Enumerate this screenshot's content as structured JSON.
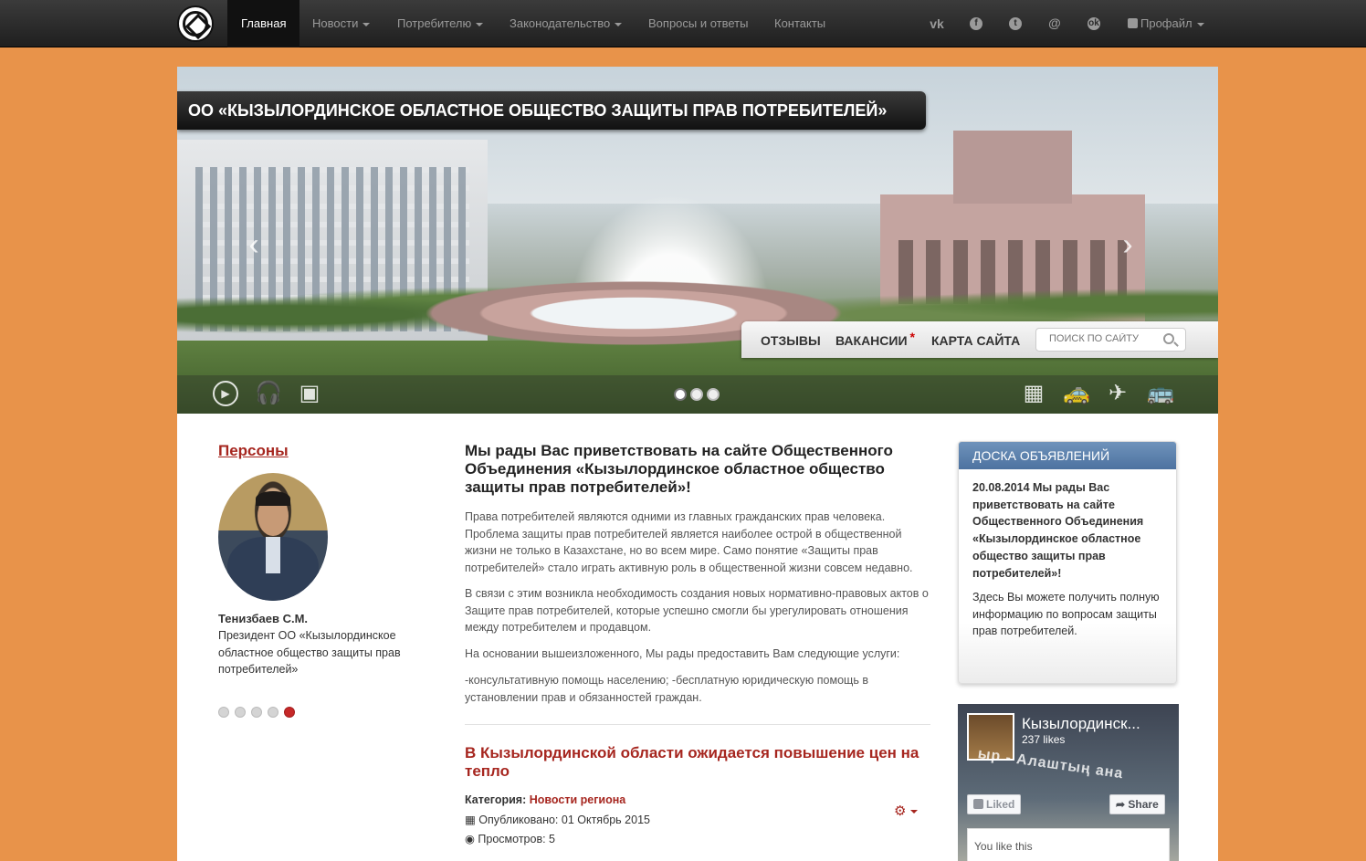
{
  "nav": {
    "items": [
      {
        "label": "Главная",
        "active": true
      },
      {
        "label": "Новости",
        "dropdown": true
      },
      {
        "label": "Потребителю",
        "dropdown": true
      },
      {
        "label": "Законодательство",
        "dropdown": true
      },
      {
        "label": "Вопросы и ответы"
      },
      {
        "label": "Контакты"
      }
    ],
    "social_icons": [
      "vk-icon",
      "facebook-icon",
      "twitter-icon",
      "mail-icon",
      "odnoklassniki-icon"
    ],
    "profile_label": "Профайл"
  },
  "slider": {
    "title": "ОО «КЫЗЫЛОРДИНСКОЕ ОБЛАСТНОЕ ОБЩЕСТВО ЗАЩИТЫ ПРАВ ПОТРЕБИТЕЛЕЙ»",
    "quicklinks": [
      "ОТЗЫВЫ",
      "ВАКАНСИИ",
      "КАРТА САЙТА"
    ],
    "vacancy_star": "*",
    "search_placeholder": "ПОИСК ПО САЙТУ",
    "dots": 3,
    "active_dot": 1,
    "left_icons": [
      "play-icon",
      "headphones-icon",
      "image-icon"
    ],
    "right_icons": [
      "map-icon",
      "taxi-icon",
      "plane-icon",
      "bus-icon"
    ]
  },
  "persons": {
    "title": "Персоны",
    "name": "Тенизбаев С.М.",
    "description": "Президент ОО «Кызылординское областное общество защиты прав потребителей»",
    "dots": 5,
    "active_dot": 5
  },
  "main": {
    "welcome": "Мы рады Вас приветствовать на сайте Общественного Объединения «Кызылординское областное общество защиты прав потребителей»!",
    "paragraphs": [
      "Права потребителей являются одними из главных гражданских прав человека. Проблема защиты прав потребителей является наиболее острой в общественной жизни не только в Казахстане, но во всем мире. Само понятие «Защиты прав потребителей» стало играть активную роль в общественной жизни совсем недавно.",
      "В связи с этим возникла необходимость создания новых нормативно-правовых актов о Защите прав потребителей, которые успешно смогли бы урегулировать отношения между потребителем и продавцом.",
      "На основании вышеизложенного, Мы рады предоставить Вам следующие услуги:",
      "-консультативную помощь населению; -бесплатную юридическую помощь в установлении прав и обязанностей граждан."
    ],
    "news": {
      "title": "В Кызылординской области ожидается повышение цен на тепло",
      "category_label": "Категория:",
      "category": "Новости региона",
      "published": "Опубликовано: 01 Октябрь 2015",
      "views": "Просмотров: 5"
    }
  },
  "board": {
    "header": "ДОСКА ОБЪЯВЛЕНИЙ",
    "title": "20.08.2014 Мы рады Вас приветствовать на сайте Общественного Объединения «Кызылординское областное общество защиты прав потребителей»!",
    "text": "Здесь Вы можете получить полную информацию по вопросам защиты прав потребителей."
  },
  "facebook": {
    "page_name": "Кызылординск...",
    "likes": "237 likes",
    "liked_label": "Liked",
    "share_label": "Share",
    "you_like": "You like this",
    "sign_text": "ыр - Алаштың ана"
  }
}
